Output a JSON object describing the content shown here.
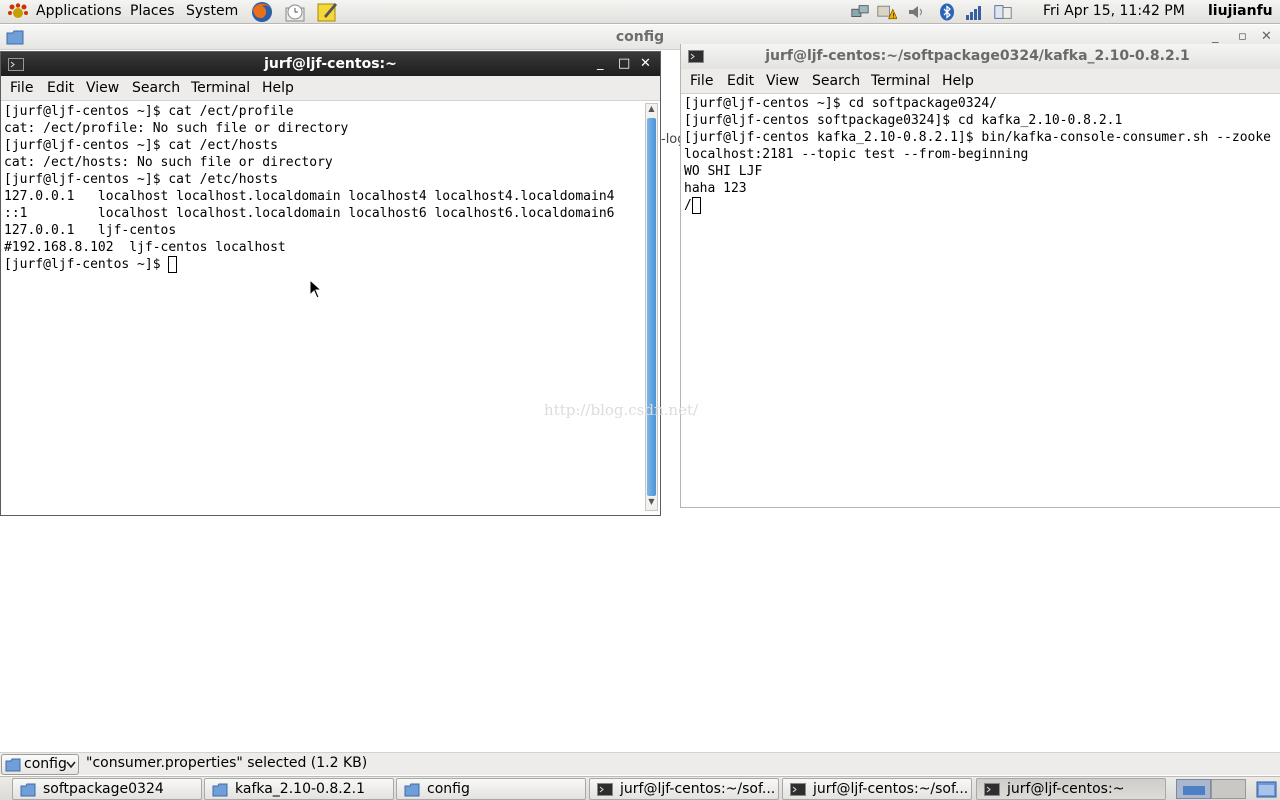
{
  "top_panel": {
    "menus": [
      "Applications",
      "Places",
      "System"
    ],
    "clock": "Fri Apr 15, 11:42 PM",
    "user": "liujianfu"
  },
  "file_manager": {
    "title": "config",
    "location": "config",
    "status": "\"consumer.properties\" selected (1.2 KB)"
  },
  "left_terminal": {
    "title": "jurf@ljf-centos:~",
    "menu": [
      "File",
      "Edit",
      "View",
      "Search",
      "Terminal",
      "Help"
    ],
    "lines": [
      "[jurf@ljf-centos ~]$ cat /ect/profile",
      "cat: /ect/profile: No such file or directory",
      "[jurf@ljf-centos ~]$ cat /ect/hosts",
      "cat: /ect/hosts: No such file or directory",
      "[jurf@ljf-centos ~]$ cat /etc/hosts",
      "127.0.0.1   localhost localhost.localdomain localhost4 localhost4.localdomain4",
      "::1         localhost localhost.localdomain localhost6 localhost6.localdomain6",
      "127.0.0.1   ljf-centos",
      "#192.168.8.102  ljf-centos localhost"
    ],
    "prompt": "[jurf@ljf-centos ~]$ "
  },
  "right_terminal": {
    "title": "jurf@ljf-centos:~/softpackage0324/kafka_2.10-0.8.2.1",
    "menu": [
      "File",
      "Edit",
      "View",
      "Search",
      "Terminal",
      "Help"
    ],
    "lines": [
      "[jurf@ljf-centos ~]$ cd softpackage0324/",
      "[jurf@ljf-centos softpackage0324]$ cd kafka_2.10-0.8.2.1",
      "[jurf@ljf-centos kafka_2.10-0.8.2.1]$ bin/kafka-console-consumer.sh --zooke",
      "localhost:2181 --topic test --from-beginning",
      "WO SHI LJF",
      "haha 123"
    ],
    "prompt": "/"
  },
  "background_snippet": "-log",
  "watermark": "http://blog.csdn.net/",
  "taskbar": [
    {
      "label": "softpackage0324",
      "icon": "folder-icon"
    },
    {
      "label": "kafka_2.10-0.8.2.1",
      "icon": "folder-icon"
    },
    {
      "label": "config",
      "icon": "folder-icon"
    },
    {
      "label": "jurf@ljf-centos:~/sof...",
      "icon": "terminal-icon"
    },
    {
      "label": "jurf@ljf-centos:~/sof...",
      "icon": "terminal-icon"
    },
    {
      "label": "jurf@ljf-centos:~",
      "icon": "terminal-icon",
      "active": true
    }
  ],
  "colors": {
    "scroll_thumb": "#4a94d6",
    "active_title": "#1d1d1d"
  }
}
